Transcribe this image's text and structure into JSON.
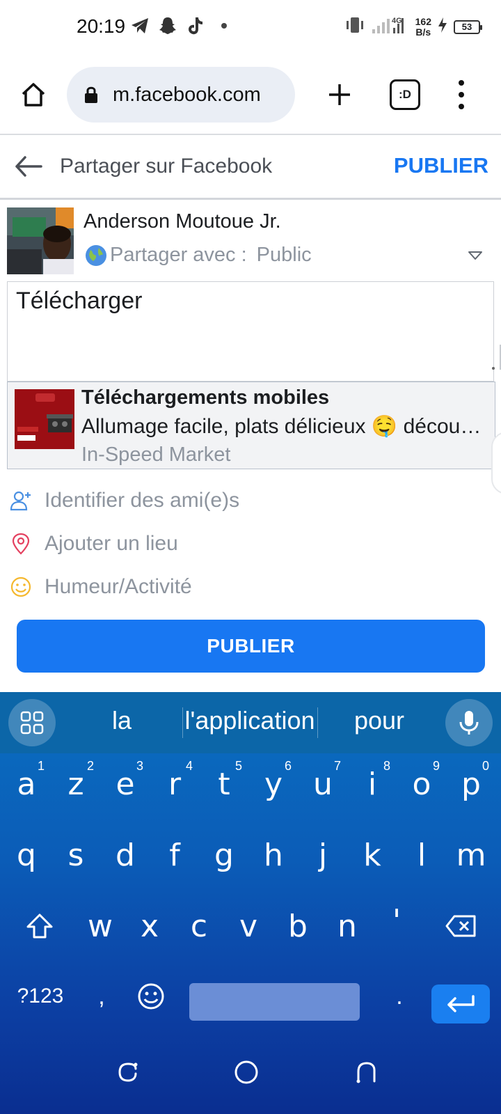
{
  "status_bar": {
    "time": "20:19",
    "speed_value": "162",
    "speed_unit": "B/s",
    "battery": "53",
    "network": "4G",
    "left_icons": [
      "telegram-icon",
      "snapchat-icon",
      "tiktok-icon"
    ],
    "right_icons": [
      "vibrate-icon",
      "signal-icon",
      "charging-icon"
    ]
  },
  "browser": {
    "url": "m.facebook.com",
    "tabs_label": ":D"
  },
  "header": {
    "title": "Partager sur Facebook",
    "publish": "PUBLIER"
  },
  "user": {
    "name": "Anderson Moutoue Jr.",
    "share_with_label": "Partager avec :",
    "audience": "Public"
  },
  "composer": {
    "text": "Télécharger"
  },
  "link_preview": {
    "title": "Téléchargements mobiles",
    "description": "Allumage facile, plats délicieux 🤤 découvrez",
    "source": "In-Speed Market",
    "thumb_texts": [
      "RECHAUD 3FEUX-GRIS -LUX",
      "22 000F",
      "Cashback 3%"
    ]
  },
  "options": [
    {
      "label": "Identifier des ami(e)s",
      "icon": "tag-friend-icon"
    },
    {
      "label": "Ajouter un lieu",
      "icon": "location-pin-icon"
    },
    {
      "label": "Humeur/Activité",
      "icon": "smiley-icon"
    }
  ],
  "publish_button": "PUBLIER",
  "keyboard": {
    "suggestions": [
      "la",
      "l'application",
      "pour"
    ],
    "row1": [
      {
        "k": "a",
        "n": "1"
      },
      {
        "k": "z",
        "n": "2"
      },
      {
        "k": "e",
        "n": "3"
      },
      {
        "k": "r",
        "n": "4"
      },
      {
        "k": "t",
        "n": "5"
      },
      {
        "k": "y",
        "n": "6"
      },
      {
        "k": "u",
        "n": "7"
      },
      {
        "k": "i",
        "n": "8"
      },
      {
        "k": "o",
        "n": "9"
      },
      {
        "k": "p",
        "n": "0"
      }
    ],
    "row2": [
      "q",
      "s",
      "d",
      "f",
      "g",
      "h",
      "j",
      "k",
      "l",
      "m"
    ],
    "row3": [
      "w",
      "x",
      "c",
      "v",
      "b",
      "n",
      "'"
    ],
    "symbols_key": "?123",
    "comma_key": ",",
    "period_key": "."
  },
  "colors": {
    "facebook_blue": "#1877f2",
    "muted_text": "#8d949e",
    "keyboard_top": "#0a6fc1",
    "keyboard_bottom": "#0a2e90"
  }
}
